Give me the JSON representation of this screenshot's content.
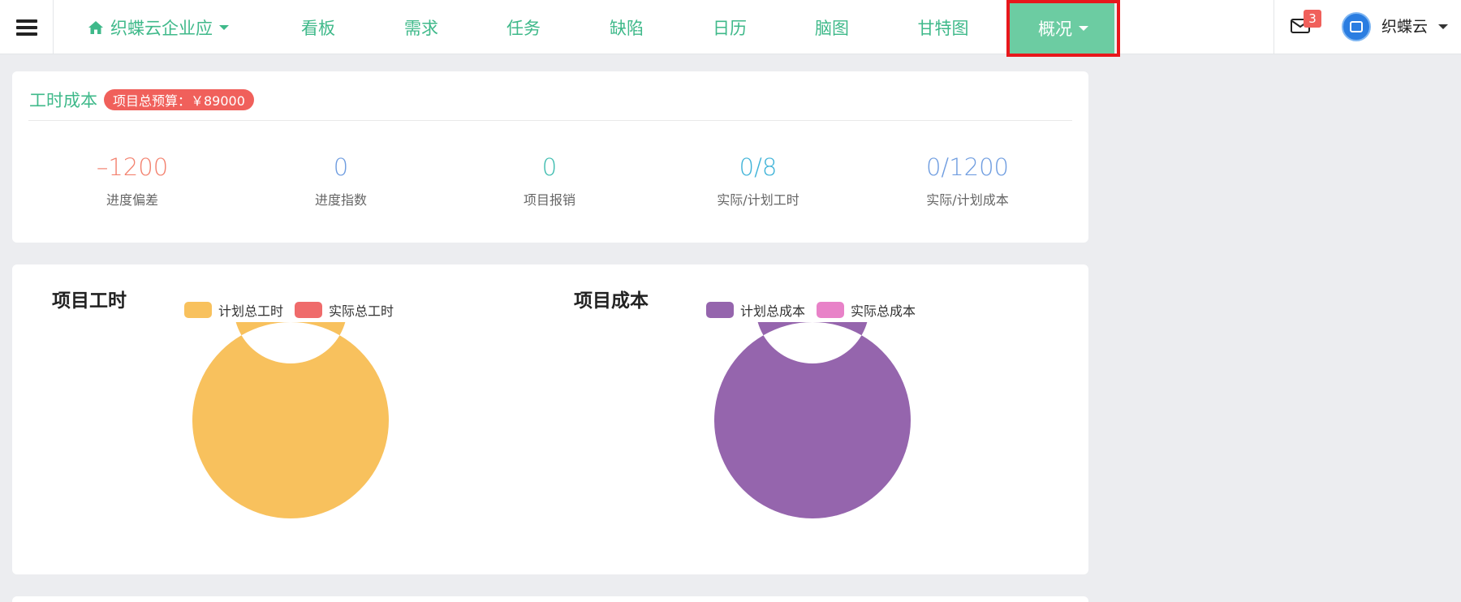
{
  "nav": {
    "project": "织蝶云企业应",
    "items": [
      "看板",
      "需求",
      "任务",
      "缺陷",
      "日历",
      "脑图",
      "甘特图"
    ],
    "active": "概况"
  },
  "header": {
    "mail_count": "3",
    "user_name": "织蝶云"
  },
  "cost_panel": {
    "title": "工时成本",
    "budget_label": "项目总预算：￥89000",
    "metrics": [
      {
        "value": "–1200",
        "label": "进度偏差",
        "color": "#f3826f"
      },
      {
        "value": "0",
        "label": "进度指数",
        "color": "#6f9de0"
      },
      {
        "value": "0",
        "label": "项目报销",
        "color": "#3fbdb0"
      },
      {
        "value": "0/8",
        "label": "实际/计划工时",
        "color": "#3fb3d8"
      },
      {
        "value": "0/1200",
        "label": "实际/计划成本",
        "color": "#6f9de0"
      }
    ]
  },
  "charts": {
    "hours": {
      "title": "项目工时",
      "legend": [
        {
          "name": "计划总工时",
          "color": "#f8c15d"
        },
        {
          "name": "实际总工时",
          "color": "#ef6b6b"
        }
      ]
    },
    "cost": {
      "title": "项目成本",
      "legend": [
        {
          "name": "计划总成本",
          "color": "#9565ad"
        },
        {
          "name": "实际总成本",
          "color": "#e882c8"
        }
      ]
    }
  },
  "chart_data": [
    {
      "type": "pie",
      "title": "项目工时",
      "categories": [
        "计划总工时",
        "实际总工时"
      ],
      "values": [
        8,
        0
      ],
      "colors": [
        "#f8c15d",
        "#ef6b6b"
      ]
    },
    {
      "type": "pie",
      "title": "项目成本",
      "categories": [
        "计划总成本",
        "实际总成本"
      ],
      "values": [
        1200,
        0
      ],
      "colors": [
        "#9565ad",
        "#e882c8"
      ]
    }
  ]
}
